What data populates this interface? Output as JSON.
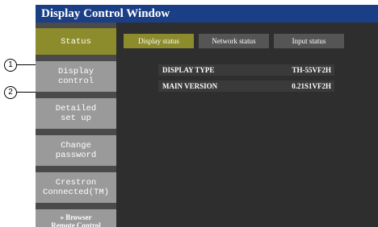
{
  "window": {
    "title": "Display Control Window"
  },
  "sidebar": {
    "items": [
      {
        "label": "Status"
      },
      {
        "label": "Display\ncontrol"
      },
      {
        "label": "Detailed\nset up"
      },
      {
        "label": "Change\npassword"
      },
      {
        "label": "Crestron\nConnected(TM)"
      },
      {
        "label": "» Browser\nRemote Control"
      }
    ]
  },
  "tabs": [
    {
      "label": "Display status",
      "active": true
    },
    {
      "label": "Network status",
      "active": false
    },
    {
      "label": "Input status",
      "active": false
    }
  ],
  "status": {
    "rows": [
      {
        "label": "DISPLAY TYPE",
        "value": "TH-55VF2H"
      },
      {
        "label": "MAIN VERSION",
        "value": "0.21S1VF2H"
      }
    ]
  },
  "callouts": [
    "1",
    "2"
  ],
  "colors": {
    "accent": "#8c8c2c",
    "titlebar": "#1b3f86",
    "sidebar_item": "#9a9a9a"
  }
}
